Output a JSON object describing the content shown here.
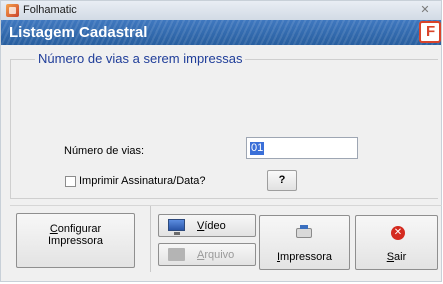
{
  "window": {
    "app_title": "Folhamatic",
    "close_symbol": "✕",
    "header_title": "Listagem Cadastral",
    "logo_letter": "F"
  },
  "group": {
    "legend": "Número de vias a serem impressas",
    "vias_label": "Número de vias:",
    "vias_value": "01",
    "print_signature_label": "Imprimir Assinatura/Data?",
    "print_signature_checked": false,
    "help_label": "?"
  },
  "buttons": {
    "config_line1_first": "C",
    "config_line1_rest": "onfigurar",
    "config_line2": "Impressora",
    "video_first": "V",
    "video_rest": "ídeo",
    "arquivo_first": "A",
    "arquivo_rest": "rquivo",
    "impressora_first": "I",
    "impressora_rest": "mpressora",
    "sair_first": "S",
    "sair_rest": "air"
  },
  "icons": {
    "app": "folhamatic-app-icon",
    "logo": "folhamatic-logo-icon",
    "video": "monitor-icon",
    "arquivo": "folder-icon",
    "impressora": "printer-icon",
    "sair": "exit-icon"
  },
  "colors": {
    "header_blue": "#2f6aae",
    "legend_blue": "#1f3d99",
    "selection_blue": "#3a6fd8",
    "exit_red": "#d42a1f"
  }
}
